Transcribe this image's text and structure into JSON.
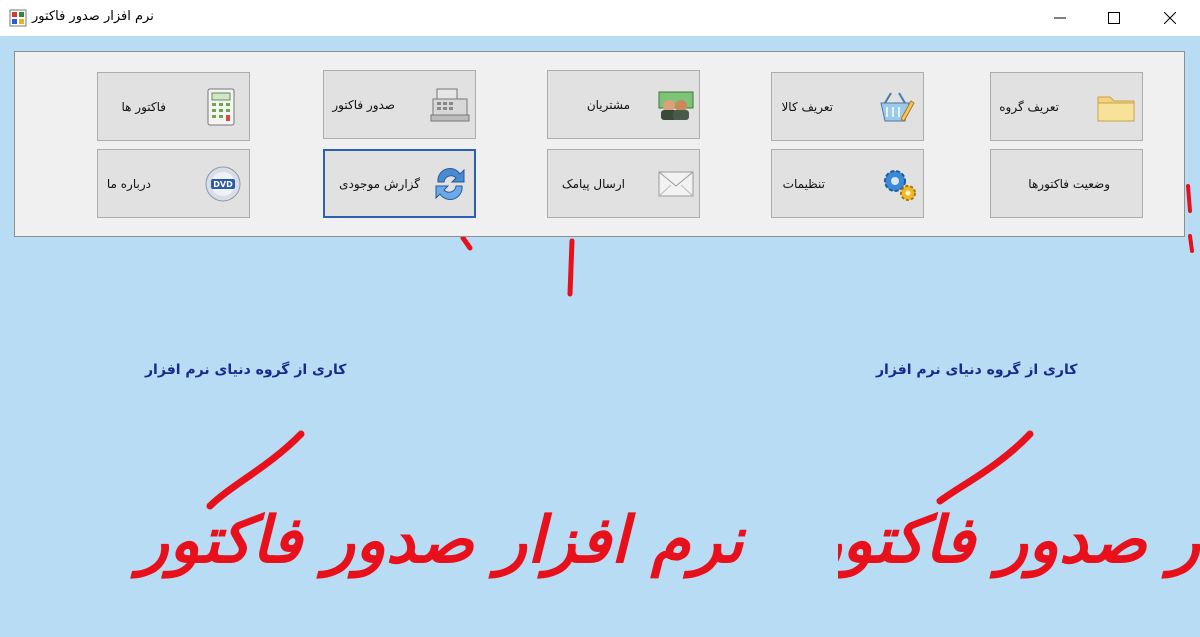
{
  "window": {
    "title": "نرم افزار صدور فاکتور"
  },
  "menu": {
    "row1": [
      {
        "id": "group",
        "label": "تعریف گروه",
        "icon": "folder-icon"
      },
      {
        "id": "product",
        "label": "تعریف کالا",
        "icon": "shopping-basket-icon"
      },
      {
        "id": "customers",
        "label": "مشتریان",
        "icon": "customers-money-icon"
      },
      {
        "id": "issue",
        "label": "صدور فاکتور",
        "icon": "cash-register-icon"
      },
      {
        "id": "invoices",
        "label": "فاکتور ها",
        "icon": "calculator-icon"
      }
    ],
    "row2": [
      {
        "id": "status",
        "label": "وضعیت فاکتورها",
        "icon": ""
      },
      {
        "id": "settings",
        "label": "تنظیمات",
        "icon": "gears-icon"
      },
      {
        "id": "sms",
        "label": "ارسال پیامک",
        "icon": "envelope-icon"
      },
      {
        "id": "inventory",
        "label": "گزارش  موجودی",
        "icon": "refresh-icon"
      },
      {
        "id": "about",
        "label": "درباره ما",
        "icon": "dvd-icon"
      }
    ]
  },
  "taglines": {
    "left": "کاری از گروه دنیای نرم افزار",
    "right": "کاری از گروه دنیای نرم افزار"
  },
  "branding": {
    "left": "نرم افزار صدور فاکتور",
    "right": "ر صدور فاکتور"
  },
  "colors": {
    "background": "#b9dcf5",
    "brand_text": "#e8101a",
    "tagline": "#1a2a8c",
    "focus": "#2a62b0"
  }
}
